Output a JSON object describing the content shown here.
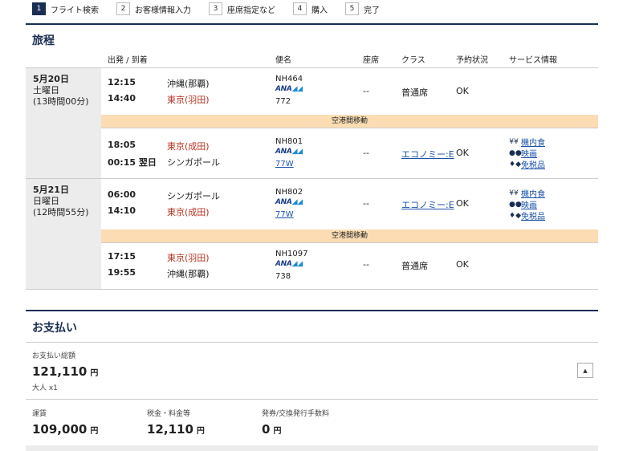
{
  "steps": [
    {
      "num": "1",
      "label": "フライト検索"
    },
    {
      "num": "2",
      "label": "お客様情報入力"
    },
    {
      "num": "3",
      "label": "座席指定など"
    },
    {
      "num": "4",
      "label": "購入"
    },
    {
      "num": "5",
      "label": "完了"
    }
  ],
  "itinerary": {
    "title": "旅程",
    "headers": {
      "depart_arrive": "出発 / 到着",
      "flight": "便名",
      "seat": "座席",
      "class": "クラス",
      "status": "予約状況",
      "service": "サービス情報"
    },
    "days": [
      {
        "date": "5月20日",
        "weekday": "土曜日",
        "duration": "(13時間00分)"
      },
      {
        "date": "5月21日",
        "weekday": "日曜日",
        "duration": "(12時間55分)"
      }
    ],
    "segments": [
      {
        "dep_time": "12:15",
        "dep_place": "沖縄(那覇)",
        "arr_time": "14:40",
        "arr_place": "東京(羽田)",
        "flight": "NH464",
        "aircraft": "772",
        "seat": "--",
        "class": "普通席",
        "status": "OK"
      },
      {
        "dep_time": "18:05",
        "dep_place": "東京(成田)",
        "arr_time": "00:15 翌日",
        "arr_place": "シンガポール",
        "flight": "NH801",
        "aircraft": "77W",
        "seat": "--",
        "class": "エコノミー:E",
        "status": "OK",
        "services": [
          "機内食",
          "映画",
          "免税品"
        ]
      },
      {
        "dep_time": "06:00",
        "dep_place": "シンガポール",
        "arr_time": "14:10",
        "arr_place": "東京(成田)",
        "flight": "NH802",
        "aircraft": "77W",
        "seat": "--",
        "class": "エコノミー:E",
        "status": "OK",
        "services": [
          "機内食",
          "映画",
          "免税品"
        ]
      },
      {
        "dep_time": "17:15",
        "dep_place": "東京(羽田)",
        "arr_time": "19:55",
        "arr_place": "沖縄(那覇)",
        "flight": "NH1097",
        "aircraft": "738",
        "seat": "--",
        "class": "普通席",
        "status": "OK"
      }
    ],
    "transfer_label": "空港間移動",
    "airline_logo": "ANA"
  },
  "payment": {
    "title": "お支払い",
    "total_label": "お支払い総額",
    "total": "121,110",
    "yen": "円",
    "pax": "大人 x1",
    "fare_label": "運賃",
    "fare": "109,000",
    "tax_label": "税金・料金等",
    "tax": "12,110",
    "fee_label": "発券/交換発行手数料",
    "fee": "0",
    "toggle_icon": "▲"
  },
  "icons": {
    "meal": "fork-knife-icon",
    "movie": "movie-icon",
    "dutyfree": "duty-free-icon",
    "toggle": "collapse-arrow-icon"
  }
}
